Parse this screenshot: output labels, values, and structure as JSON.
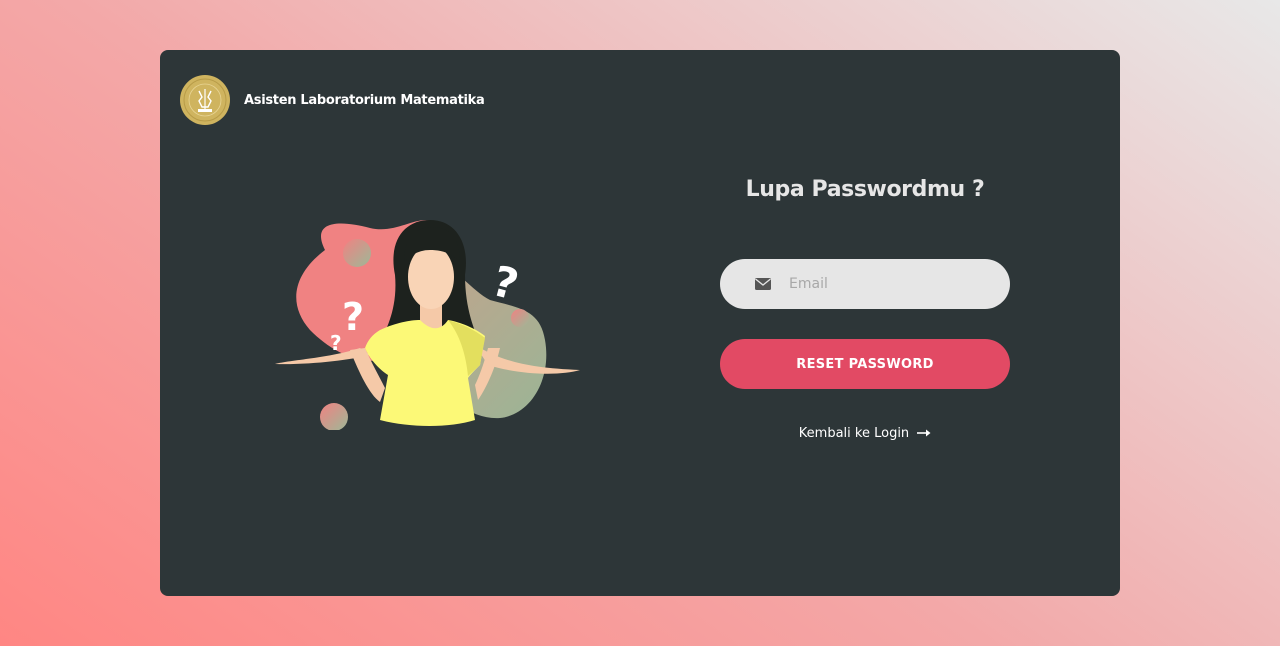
{
  "brand": {
    "name": "Asisten Laboratorium Matematika",
    "logo_icon": "university-seal-icon"
  },
  "illustration": {
    "icon": "confused-woman-illustration",
    "question_marks": [
      "?",
      "?",
      "?"
    ]
  },
  "form": {
    "title": "Lupa Passwordmu ?",
    "email_icon": "envelope-icon",
    "email_placeholder": "Email",
    "email_value": "",
    "submit_label": "RESET PASSWORD",
    "back_label": "Kembali ke Login",
    "back_icon": "arrow-right-icon"
  },
  "colors": {
    "card_bg": "#2d3638",
    "accent": "#e24a64",
    "input_bg": "#e6e6e6",
    "logo_gold": "#cfb45f"
  }
}
